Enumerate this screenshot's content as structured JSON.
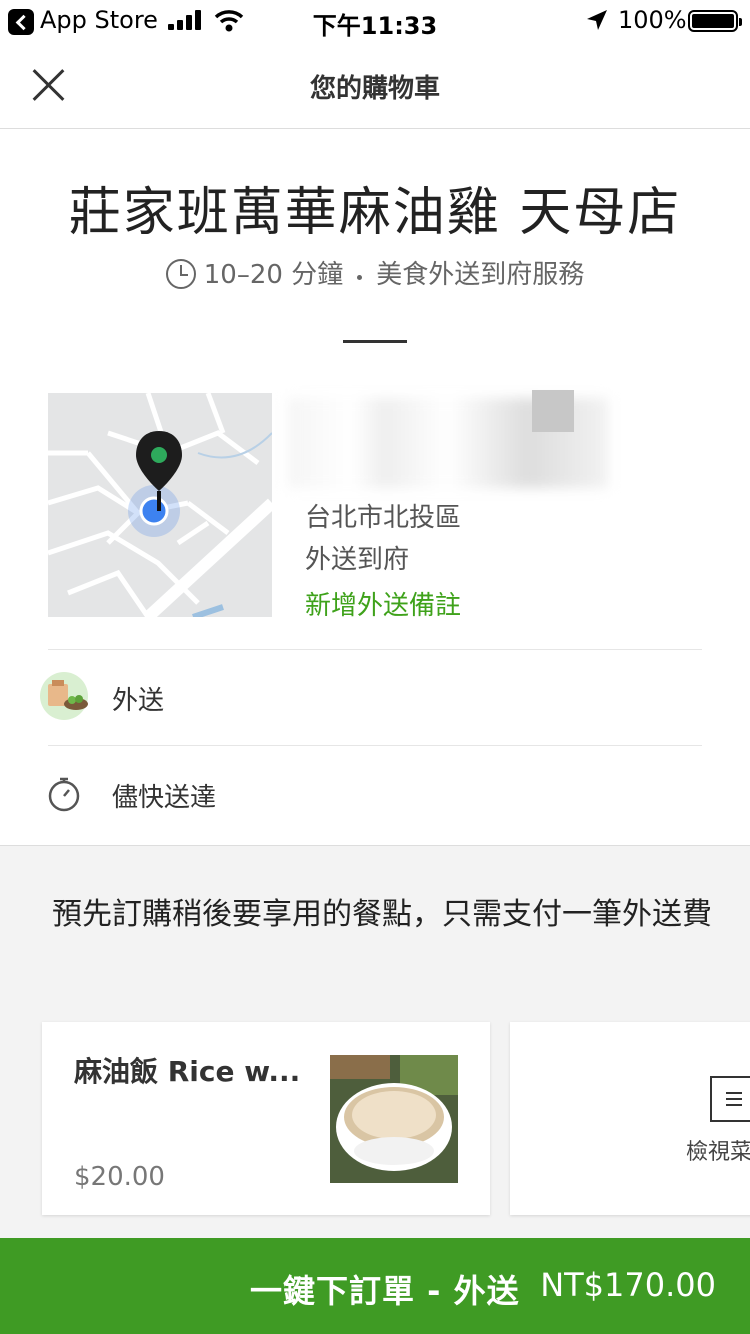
{
  "status_bar": {
    "back_app": "App Store",
    "time": "下午11:33",
    "battery": "100%"
  },
  "nav": {
    "title": "您的購物車"
  },
  "store": {
    "name": "莊家班萬華麻油雞 天母店",
    "eta": "10–20 分鐘",
    "service": "美食外送到府服務"
  },
  "address": {
    "district": "台北市北投區",
    "delivery_type": "外送到府",
    "add_note": "新增外送備註"
  },
  "options": [
    {
      "label": "外送",
      "icon": "delivery-bag-icon"
    },
    {
      "label": "儘快送達",
      "icon": "stopwatch-icon"
    }
  ],
  "promo": {
    "text": "預先訂購稍後要享用的餐點，只需支付一筆外送費"
  },
  "suggested_items": [
    {
      "name": "麻油飯 Rice w...",
      "price": "$20.00"
    }
  ],
  "view_menu": {
    "label": "檢視菜"
  },
  "checkout": {
    "label": "一鍵下訂單 - 外送",
    "total": "NT$170.00",
    "color": "#3f9b24"
  }
}
